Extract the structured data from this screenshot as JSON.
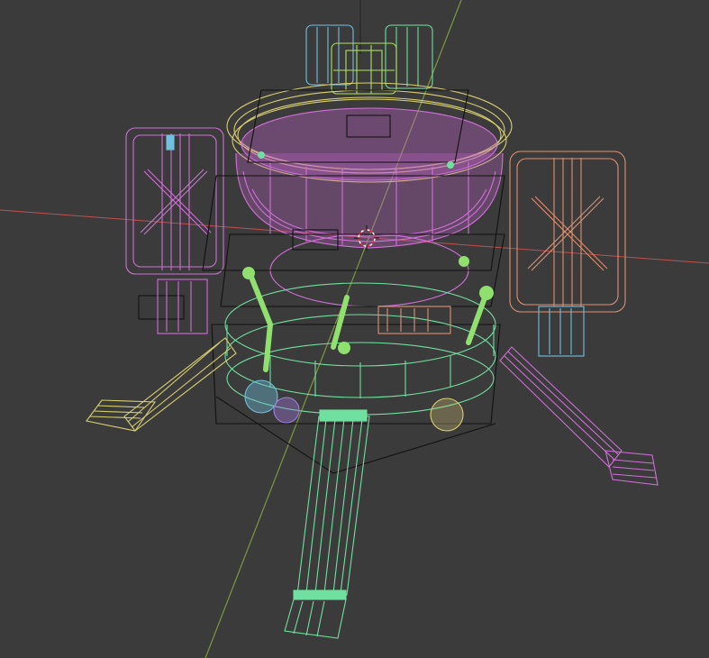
{
  "viewport": {
    "background": "#3b3b3b",
    "axis_x_color": "#c0504d",
    "axis_y_color": "#7a9a3a",
    "object_colors": {
      "pink": "#d070d8",
      "yellow": "#d8d070",
      "green": "#70e0a0",
      "lime": "#b0e060",
      "cyan": "#70c0e0",
      "salmon": "#e09070",
      "black": "#111111"
    },
    "icons": [
      "3d-cursor-icon"
    ]
  }
}
